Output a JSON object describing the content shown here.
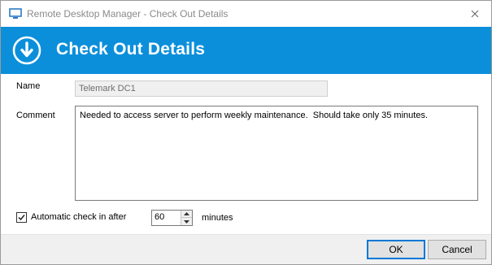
{
  "window": {
    "title": "Remote Desktop Manager - Check Out Details"
  },
  "banner": {
    "title": "Check Out Details",
    "icon": "download-circle-icon",
    "color": "#0b8fdb"
  },
  "form": {
    "name_label": "Name",
    "name_value": "Telemark DC1",
    "comment_label": "Comment",
    "comment_value": "Needed to access server to perform weekly maintenance.  Should take only 35 minutes.",
    "auto_checkin_label": "Automatic check in after",
    "auto_checkin_checked": true,
    "auto_checkin_minutes": "60",
    "minutes_label": "minutes"
  },
  "footer": {
    "ok_label": "OK",
    "cancel_label": "Cancel"
  }
}
